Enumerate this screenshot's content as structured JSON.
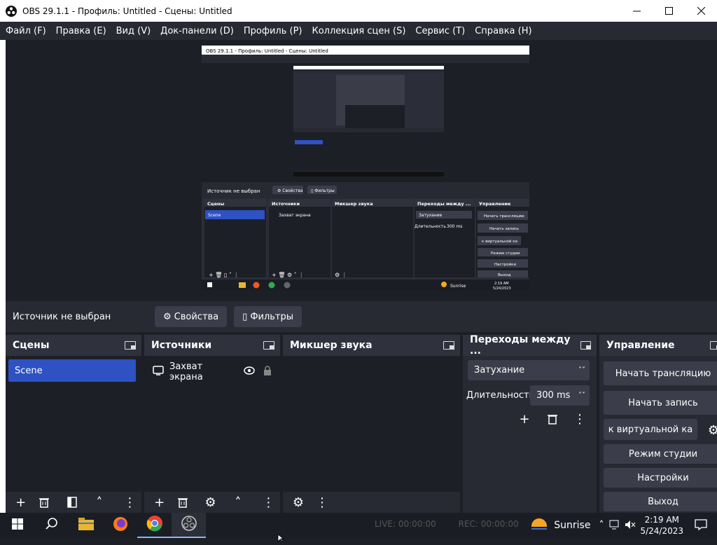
{
  "window": {
    "title": "OBS 29.1.1 - Профиль: Untitled - Сцены: Untitled"
  },
  "menu": [
    "Файл (F)",
    "Правка (E)",
    "Вид (V)",
    "Док-панели (D)",
    "Профиль (P)",
    "Коллекция сцен (S)",
    "Сервис (T)",
    "Справка (H)"
  ],
  "preview_inner": {
    "title": "OBS 29.1.1 - Профиль: Untitled - Сцены: Untitled",
    "source_label": "Источник не выбран",
    "docks": [
      "Сцены",
      "Источники",
      "Микшер звука",
      "Переходы между ...",
      "Управление"
    ],
    "scene": "Scene",
    "source": "Захват экрана",
    "transition": "Затухание",
    "duration_label": "Длительность",
    "duration": "300 ms",
    "controls": [
      "Начать трансляцию",
      "Начать запись",
      "к виртуальной ка",
      "Режим студии",
      "Настройки",
      "Выход"
    ],
    "tray_weather": "Sunrise",
    "time": "2:19 AM",
    "date": "5/24/2023"
  },
  "source_bar": {
    "no_source": "Источник не выбран",
    "properties": "Свойства",
    "filters": "Фильтры"
  },
  "docks": {
    "scenes": {
      "title": "Сцены",
      "items": [
        "Scene"
      ]
    },
    "sources": {
      "title": "Источники",
      "items": [
        "Захват экрана"
      ]
    },
    "mixer": {
      "title": "Микшер звука"
    },
    "transitions": {
      "title": "Переходы между ...",
      "transition": "Затухание",
      "duration_label": "Длительность",
      "duration": "300 ms"
    },
    "controls": {
      "title": "Управление",
      "start_stream": "Начать трансляцию",
      "start_record": "Начать запись",
      "virtual_cam": "к виртуальной ка",
      "studio_mode": "Режим студии",
      "settings": "Настройки",
      "exit": "Выход"
    }
  },
  "status": {
    "live": "LIVE: 00:00:00",
    "rec": "REC: 00:00:00"
  },
  "taskbar": {
    "weather": "Sunrise",
    "time": "2:19 AM",
    "date": "5/24/2023"
  },
  "colors": {
    "selected": "#2e52c3",
    "dock_bg": "#272a33",
    "content_bg": "#1d1f26",
    "button": "#3b3e4a"
  }
}
